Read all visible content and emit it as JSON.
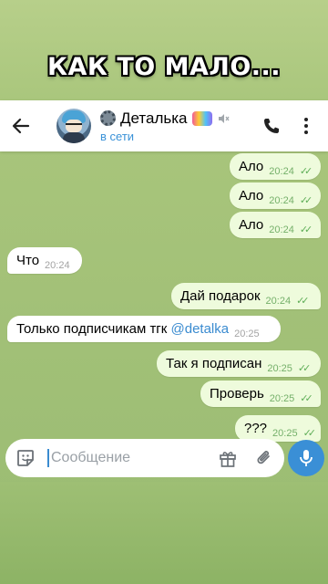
{
  "caption": "КАК ТО МАЛО...",
  "header": {
    "title": "Деталька",
    "status": "в сети"
  },
  "messages": [
    {
      "dir": "out",
      "text": "Ало",
      "time": "20:24",
      "checks": "✓✓"
    },
    {
      "dir": "out",
      "text": "Ало",
      "time": "20:24",
      "checks": "✓✓"
    },
    {
      "dir": "out",
      "text": "Ало",
      "time": "20:24",
      "checks": "✓✓"
    },
    {
      "dir": "in",
      "text": "Что",
      "time": "20:24"
    },
    {
      "dir": "out",
      "text": "Дай подарок",
      "time": "20:24",
      "checks": "✓✓"
    },
    {
      "dir": "in",
      "text": "Только подписчикам тгк ",
      "link": "@detalka",
      "time": "20:25"
    },
    {
      "dir": "out",
      "text": "Так я подписан",
      "time": "20:25",
      "checks": "✓✓"
    },
    {
      "dir": "out",
      "text": "Проверь",
      "time": "20:25",
      "checks": "✓✓"
    },
    {
      "dir": "out",
      "text": "???",
      "time": "20:25",
      "checks": "✓✓"
    }
  ],
  "input": {
    "placeholder": "Сообщение"
  },
  "icons": {
    "back": "arrow-left-icon",
    "mute": "mute-icon",
    "call": "phone-icon",
    "menu": "more-vertical-icon",
    "sticker": "sticker-icon",
    "gift": "gift-icon",
    "attach": "paperclip-icon",
    "mic": "microphone-icon"
  },
  "colors": {
    "accent": "#3a8fd6",
    "outgoing_bubble": "#eefbdc",
    "incoming_bubble": "#ffffff"
  }
}
